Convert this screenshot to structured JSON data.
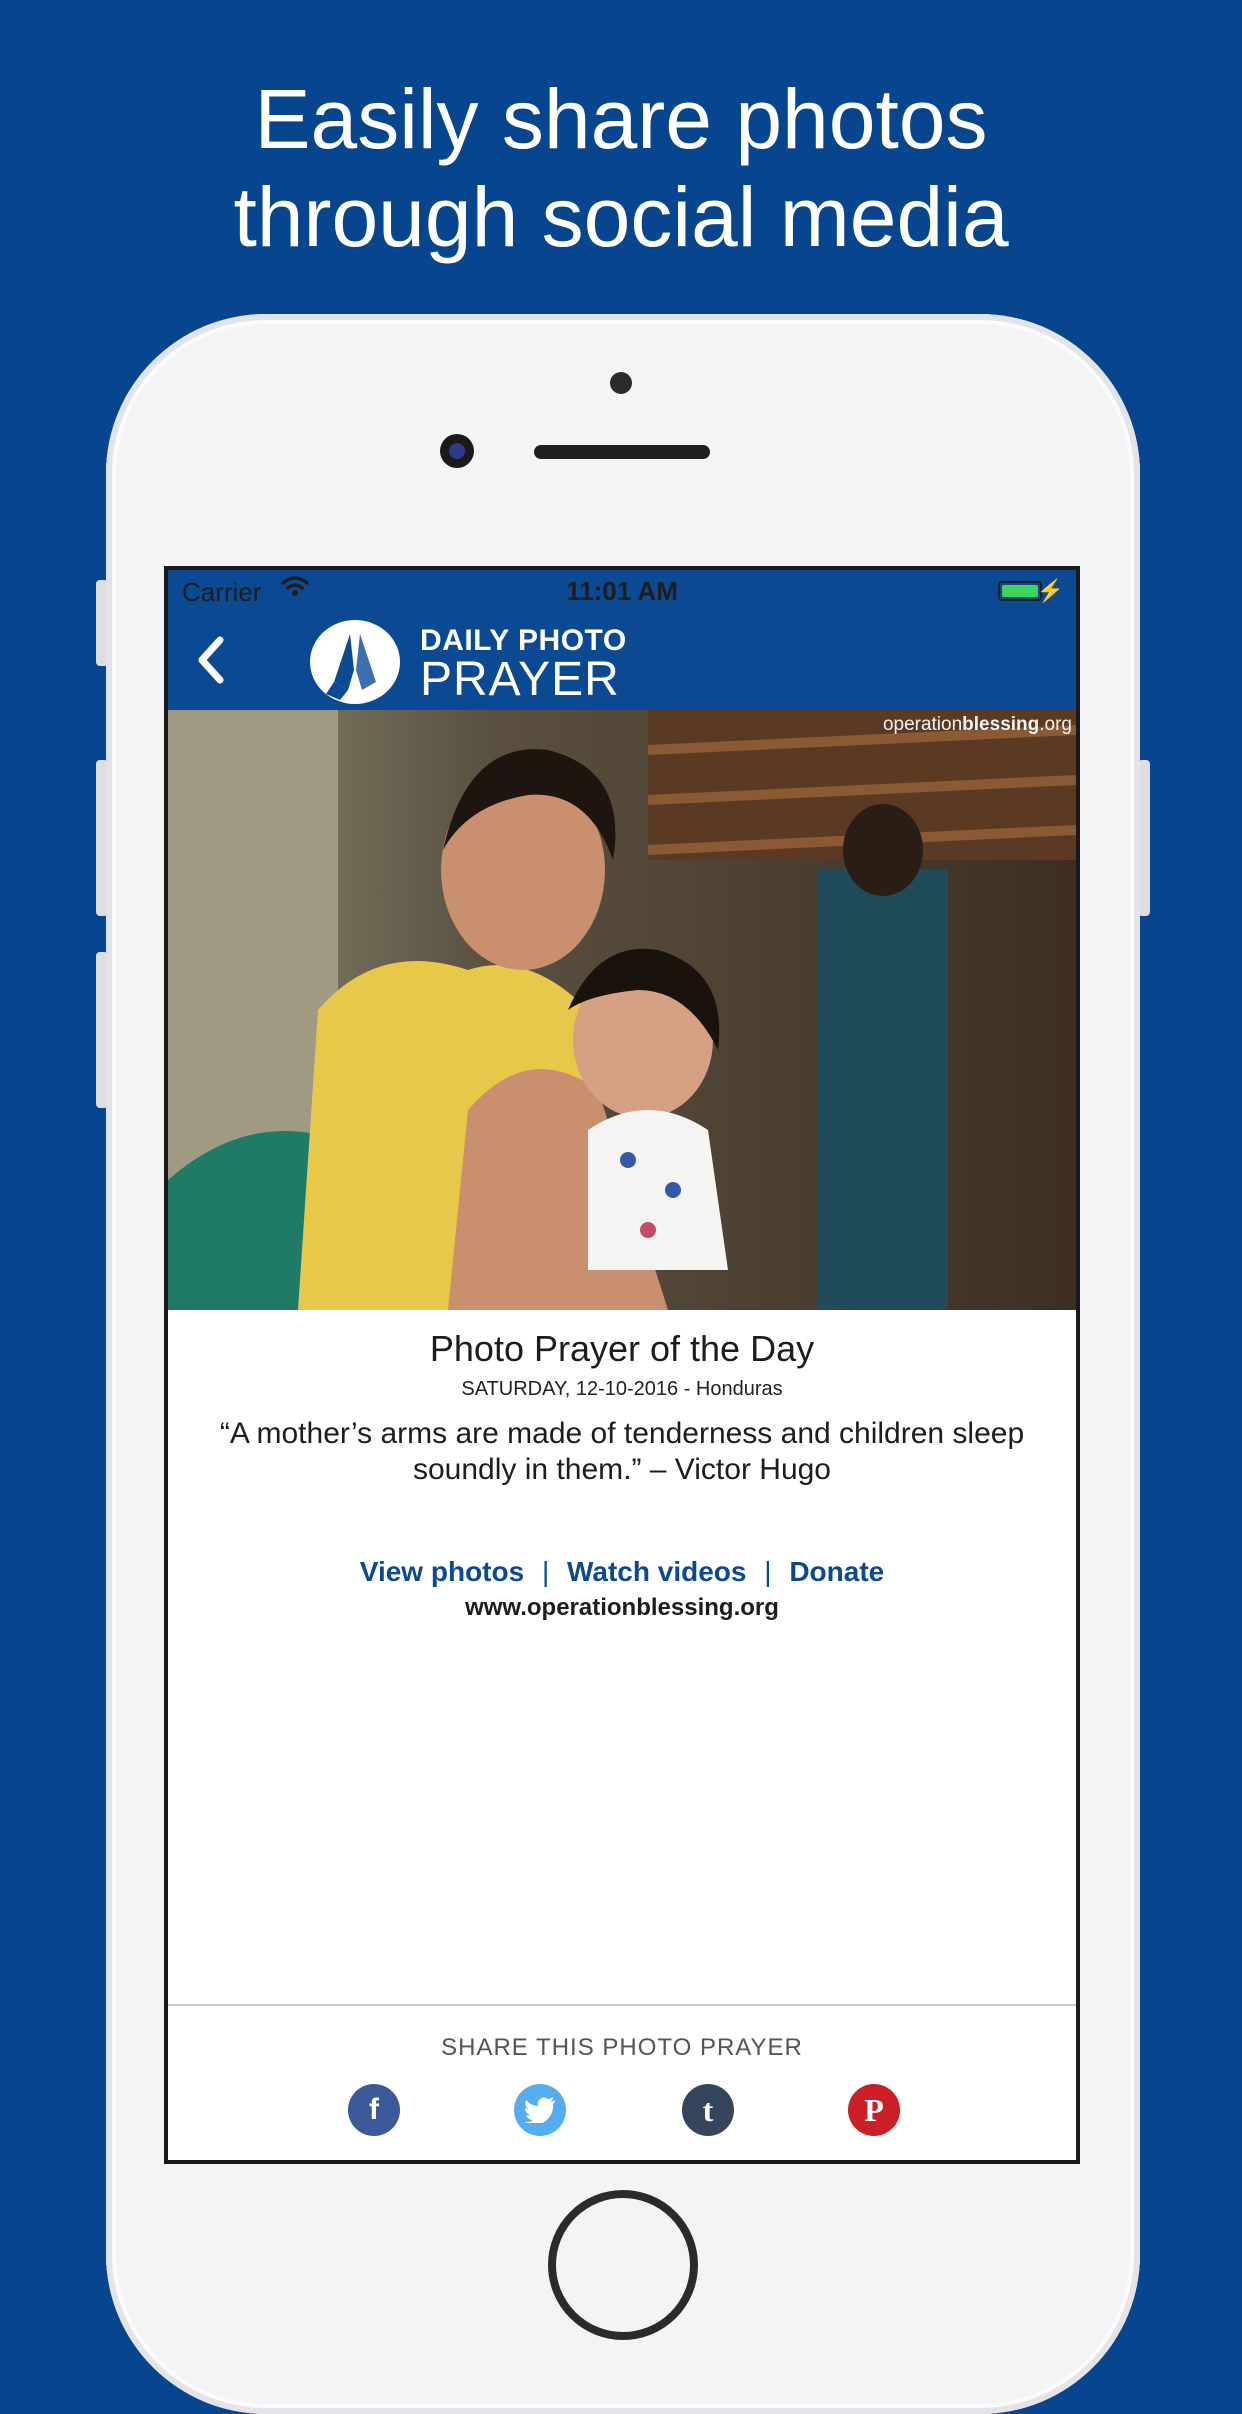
{
  "headline": {
    "line1": "Easily share photos",
    "line2": "through social media"
  },
  "statusbar": {
    "carrier": "Carrier",
    "time": "11:01 AM"
  },
  "navbar": {
    "back_icon": "chevron-left-icon",
    "logo_line1": "DAILY PHOTO",
    "logo_line2": "PRAYER",
    "logo_icon": "praying-hands-icon"
  },
  "photo": {
    "watermark_prefix": "operation",
    "watermark_bold": "blessing",
    "watermark_suffix": ".org"
  },
  "content": {
    "title": "Photo Prayer of the Day",
    "dateline": "SATURDAY, 12-10-2016 - Honduras",
    "quote": "“A mother’s arms are made of tenderness and children sleep soundly in them.” – Victor Hugo",
    "links": [
      "View photos",
      "Watch videos",
      "Donate"
    ],
    "separator": "|",
    "site": "www.operationblessing.org"
  },
  "share": {
    "label": "SHARE THIS PHOTO PRAYER",
    "icons": [
      {
        "name": "facebook-icon",
        "glyph": "f",
        "color": "#3b5998"
      },
      {
        "name": "twitter-icon",
        "glyph": "t",
        "color": "#55acee"
      },
      {
        "name": "tumblr-icon",
        "glyph": "t",
        "color": "#35465c"
      },
      {
        "name": "pinterest-icon",
        "glyph": "P",
        "color": "#cb2027"
      }
    ]
  },
  "colors": {
    "background": "#07468f",
    "navbar": "#0b4a93",
    "link": "#0b4a93"
  }
}
